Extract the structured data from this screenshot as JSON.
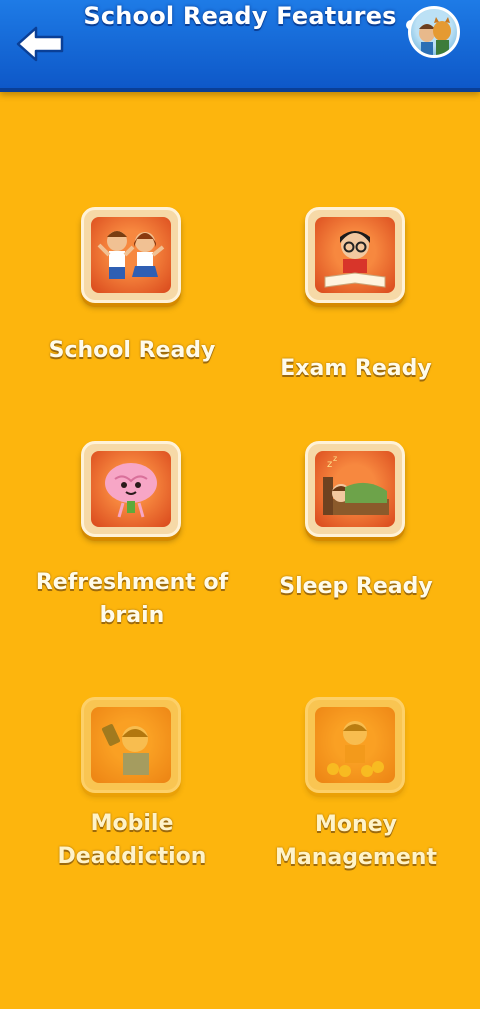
{
  "header": {
    "title": "School Ready Features",
    "back_icon": "arrow-left-icon",
    "avatar_icon": "character-avatar-icon",
    "bar_color": "#1E7BE6"
  },
  "page": {
    "background_color": "#FDB50D"
  },
  "features": [
    {
      "label_lines": [
        "School Ready"
      ],
      "icon": "two-students-icon",
      "enabled": true
    },
    {
      "label_lines": [
        "Exam Ready"
      ],
      "icon": "boy-studying-book-icon",
      "enabled": true
    },
    {
      "label_lines": [
        "Refreshment of",
        "brain"
      ],
      "icon": "happy-brain-icon",
      "enabled": true
    },
    {
      "label_lines": [
        "Sleep Ready"
      ],
      "icon": "child-sleeping-in-bed-icon",
      "enabled": true
    },
    {
      "label_lines": [
        "Mobile",
        "Deaddiction"
      ],
      "icon": "child-with-phone-icon",
      "enabled": false
    },
    {
      "label_lines": [
        "Money",
        "Management"
      ],
      "icon": "child-with-coins-icon",
      "enabled": false
    }
  ]
}
